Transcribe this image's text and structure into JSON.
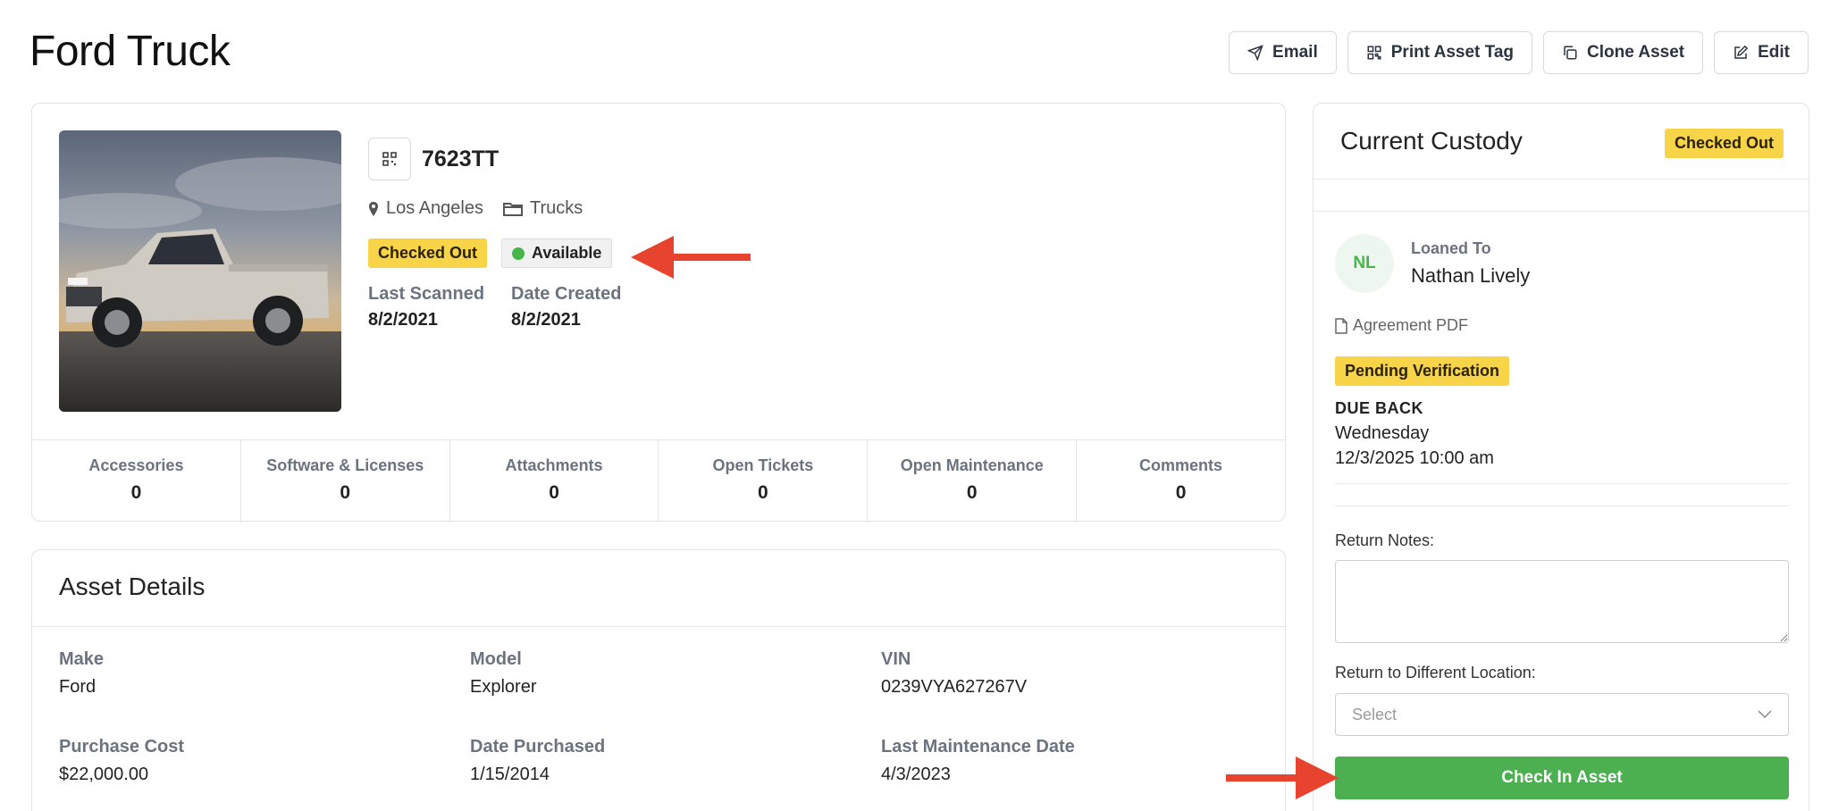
{
  "page": {
    "title": "Ford Truck"
  },
  "toolbar": {
    "email_label": "Email",
    "print_label": "Print Asset Tag",
    "clone_label": "Clone Asset",
    "edit_label": "Edit"
  },
  "asset": {
    "tag": "7623TT",
    "location": "Los Angeles",
    "category": "Trucks",
    "status_badge": "Checked Out",
    "availability": "Available",
    "availability_color": "#47b64a",
    "last_scanned_label": "Last Scanned",
    "last_scanned": "8/2/2021",
    "date_created_label": "Date Created",
    "date_created": "8/2/2021"
  },
  "stats": [
    {
      "label": "Accessories",
      "value": "0"
    },
    {
      "label": "Software & Licenses",
      "value": "0"
    },
    {
      "label": "Attachments",
      "value": "0"
    },
    {
      "label": "Open Tickets",
      "value": "0"
    },
    {
      "label": "Open Maintenance",
      "value": "0"
    },
    {
      "label": "Comments",
      "value": "0"
    }
  ],
  "details": {
    "title": "Asset Details",
    "fields": [
      {
        "label": "Make",
        "value": "Ford"
      },
      {
        "label": "Model",
        "value": "Explorer"
      },
      {
        "label": "VIN",
        "value": "0239VYA627267V"
      },
      {
        "label": "Purchase Cost",
        "value": "$22,000.00"
      },
      {
        "label": "Date Purchased",
        "value": "1/15/2014"
      },
      {
        "label": "Last Maintenance Date",
        "value": "4/3/2023"
      }
    ]
  },
  "custody": {
    "title": "Current Custody",
    "status_badge": "Checked Out",
    "avatar_initials": "NL",
    "loaned_to_label": "Loaned To",
    "loaned_to_name": "Nathan Lively",
    "agreement_link": "Agreement PDF",
    "verification_badge": "Pending Verification",
    "due_back_label": "DUE BACK",
    "due_back_day": "Wednesday",
    "due_back_datetime": "12/3/2025 10:00 am",
    "return_notes_label": "Return Notes:",
    "return_notes_value": "",
    "return_location_label": "Return to Different Location:",
    "return_location_placeholder": "Select",
    "checkin_label": "Check In Asset"
  },
  "colors": {
    "badge_yellow": "#f7d448",
    "checkin_green": "#4caf50",
    "annotation_arrow": "#e8432e"
  }
}
